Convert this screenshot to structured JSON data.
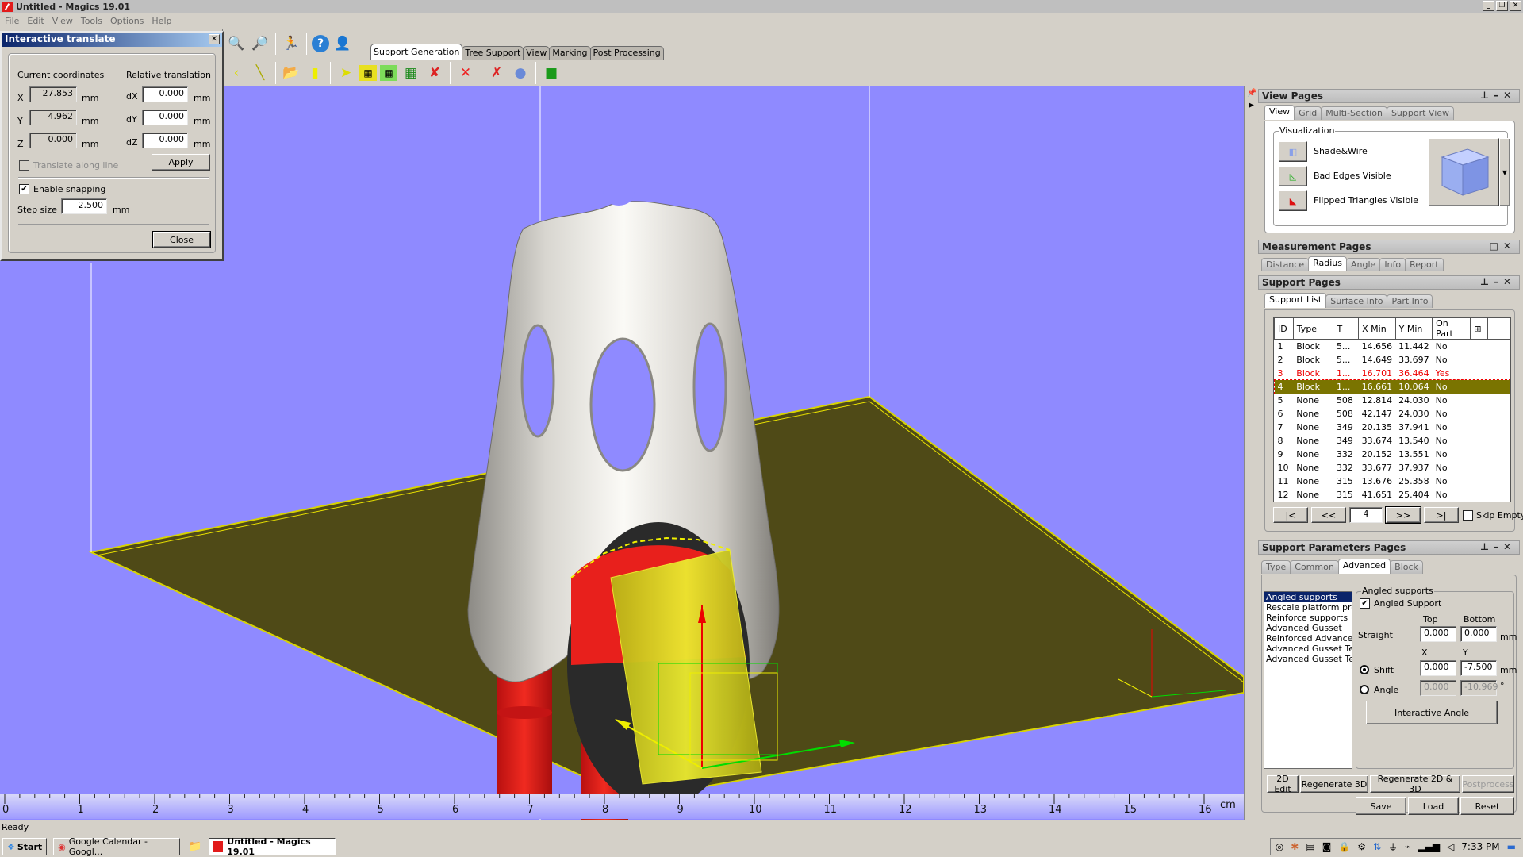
{
  "window": {
    "title": "Untitled - Magics 19.01",
    "controls": [
      "_",
      "❐",
      "✕"
    ]
  },
  "menu": [
    "File",
    "Edit",
    "View",
    "Tools",
    "Options",
    "Help"
  ],
  "toolbar": {
    "ribbon_tabs": [
      "Support Generation",
      "Tree Support",
      "View",
      "Marking",
      "Post Processing"
    ],
    "active_tab": "Support Generation",
    "top_icons": [
      "zoom-icon",
      "zoom-cancel-icon",
      "exit-icon",
      "help-icon",
      "support-agent-icon"
    ],
    "bottom_icons": [
      "arrow-icon",
      "line-icon",
      "open-folder-icon",
      "cone-support-icon",
      "select-icon",
      "select-surface-icon",
      "select-area-icon",
      "grid-select-icon",
      "deselect-icon",
      "delete-icon",
      "delete-numbered-icon",
      "sphere-icon",
      "block-3d-icon"
    ]
  },
  "dialog": {
    "title": "Interactive translate",
    "current_coordinates_label": "Current coordinates",
    "relative_translation_label": "Relative translation",
    "coords": [
      {
        "axis": "X",
        "value": "27.853",
        "unit": "mm",
        "rel_label": "dX",
        "rel_value": "0.000",
        "rel_unit": "mm"
      },
      {
        "axis": "Y",
        "value": "4.962",
        "unit": "mm",
        "rel_label": "dY",
        "rel_value": "0.000",
        "rel_unit": "mm"
      },
      {
        "axis": "Z",
        "value": "0.000",
        "unit": "mm",
        "rel_label": "dZ",
        "rel_value": "0.000",
        "rel_unit": "mm"
      }
    ],
    "translate_along_line": {
      "label": "Translate along line",
      "checked": false,
      "enabled": false
    },
    "apply_label": "Apply",
    "enable_snapping": {
      "label": "Enable snapping",
      "checked": true
    },
    "step_size": {
      "label": "Step size",
      "value": "2.500",
      "unit": "mm"
    },
    "close_label": "Close"
  },
  "ruler": {
    "labels": [
      "0",
      "1",
      "2",
      "3",
      "4",
      "5",
      "6",
      "7",
      "8",
      "9",
      "10",
      "11",
      "12",
      "13",
      "14",
      "15",
      "16"
    ],
    "unit": "cm"
  },
  "view_pages": {
    "title": "View Pages",
    "tabs": [
      "View",
      "Grid",
      "Multi-Section",
      "Support View"
    ],
    "active_tab": "View",
    "group_title": "Visualization",
    "options": [
      "Shade&Wire",
      "Bad Edges Visible",
      "Flipped Triangles Visible"
    ]
  },
  "measurement_pages": {
    "title": "Measurement Pages",
    "tabs": [
      "Distance",
      "Radius",
      "Angle",
      "Info",
      "Report"
    ],
    "active_tab": "Radius"
  },
  "support_pages": {
    "title": "Support Pages",
    "tabs": [
      "Support List",
      "Surface Info",
      "Part Info"
    ],
    "active_tab": "Support List",
    "columns": [
      "ID",
      "Type",
      "T",
      "X Min",
      "Y Min",
      "On Part"
    ],
    "rows": [
      {
        "id": "1",
        "type": "Block",
        "t": "5...",
        "xmin": "14.656",
        "ymin": "11.442",
        "on_part": "No",
        "state": ""
      },
      {
        "id": "2",
        "type": "Block",
        "t": "5...",
        "xmin": "14.649",
        "ymin": "33.697",
        "on_part": "No",
        "state": ""
      },
      {
        "id": "3",
        "type": "Block",
        "t": "1...",
        "xmin": "16.701",
        "ymin": "36.464",
        "on_part": "Yes",
        "state": "warn"
      },
      {
        "id": "4",
        "type": "Block",
        "t": "1...",
        "xmin": "16.661",
        "ymin": "10.064",
        "on_part": "No",
        "state": "sel"
      },
      {
        "id": "5",
        "type": "None",
        "t": "508",
        "xmin": "12.814",
        "ymin": "24.030",
        "on_part": "No",
        "state": ""
      },
      {
        "id": "6",
        "type": "None",
        "t": "508",
        "xmin": "42.147",
        "ymin": "24.030",
        "on_part": "No",
        "state": ""
      },
      {
        "id": "7",
        "type": "None",
        "t": "349",
        "xmin": "20.135",
        "ymin": "37.941",
        "on_part": "No",
        "state": ""
      },
      {
        "id": "8",
        "type": "None",
        "t": "349",
        "xmin": "33.674",
        "ymin": "13.540",
        "on_part": "No",
        "state": ""
      },
      {
        "id": "9",
        "type": "None",
        "t": "332",
        "xmin": "20.152",
        "ymin": "13.551",
        "on_part": "No",
        "state": ""
      },
      {
        "id": "10",
        "type": "None",
        "t": "332",
        "xmin": "33.677",
        "ymin": "37.937",
        "on_part": "No",
        "state": ""
      },
      {
        "id": "11",
        "type": "None",
        "t": "315",
        "xmin": "13.676",
        "ymin": "25.358",
        "on_part": "No",
        "state": ""
      },
      {
        "id": "12",
        "type": "None",
        "t": "315",
        "xmin": "41.651",
        "ymin": "25.404",
        "on_part": "No",
        "state": ""
      }
    ],
    "nav": {
      "first": "|<",
      "prev": "<<",
      "current": "4",
      "next": ">>",
      "last": ">|"
    },
    "skip_empty": {
      "label": "Skip Empty",
      "checked": false
    }
  },
  "support_params": {
    "title": "Support Parameters Pages",
    "tabs": [
      "Type",
      "Common",
      "Advanced",
      "Block"
    ],
    "active_tab": "Advanced",
    "list": [
      "Angled supports",
      "Rescale platform proje",
      "Reinforce supports",
      "Advanced Gusset",
      "Reinforced Advanced (",
      "Advanced Gusset Teet",
      "Advanced Gusset Teet"
    ],
    "selected_index": 0,
    "group_title": "Angled supports",
    "angled_support": {
      "label": "Angled Support",
      "checked": true
    },
    "col_top": "Top",
    "col_bottom": "Bottom",
    "straight": {
      "label": "Straight",
      "top": "0.000",
      "bottom": "0.000",
      "unit": "mm"
    },
    "col_x": "X",
    "col_y": "Y",
    "shift": {
      "label": "Shift",
      "selected": true,
      "x": "0.000",
      "y": "-7.500",
      "unit": "mm"
    },
    "angle": {
      "label": "Angle",
      "selected": false,
      "x": "0.000",
      "y": "-10.969",
      "unit": "°"
    },
    "interactive_angle_label": "Interactive Angle",
    "buttons": [
      "2D Edit",
      "Regenerate 3D",
      "Regenerate 2D & 3D",
      "Postprocess"
    ],
    "buttons2": [
      "Save",
      "Load",
      "Reset"
    ]
  },
  "statusbar": {
    "text": "Ready"
  },
  "taskbar": {
    "start": "Start",
    "items": [
      "Google Calendar - Googl...",
      "Untitled - Magics 19.01"
    ],
    "clock": "7:33 PM"
  },
  "colors": {
    "viewport_bg": "#8f8aff",
    "platform": "#4f4a17",
    "support_red": "#e8201c",
    "support_yellow": "#e0dc20",
    "selection_row": "#7a7400"
  }
}
